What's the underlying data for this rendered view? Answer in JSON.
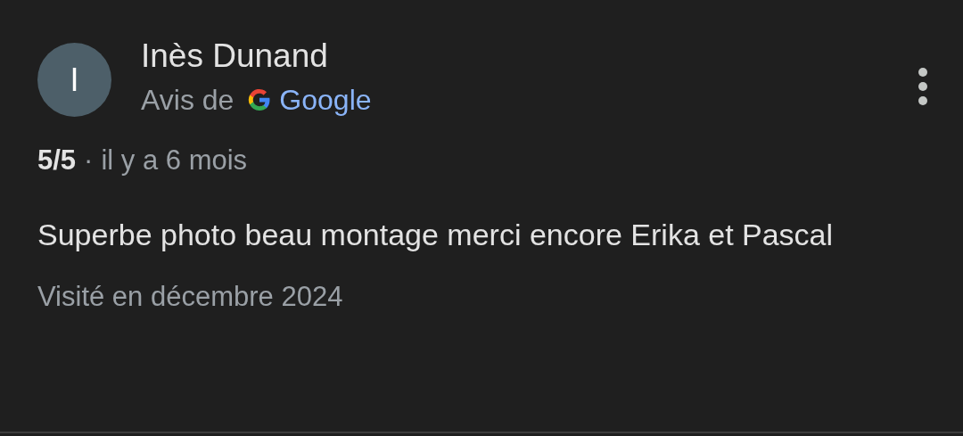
{
  "review": {
    "author": {
      "initial": "I",
      "name": "Inès Dunand"
    },
    "source": {
      "prefix": "Avis de",
      "name": "Google"
    },
    "rating": "5/5",
    "separator": "·",
    "time": "il y a 6 mois",
    "text": "Superbe photo beau montage merci encore Erika et Pascal",
    "visit": "Visité en décembre 2024"
  }
}
